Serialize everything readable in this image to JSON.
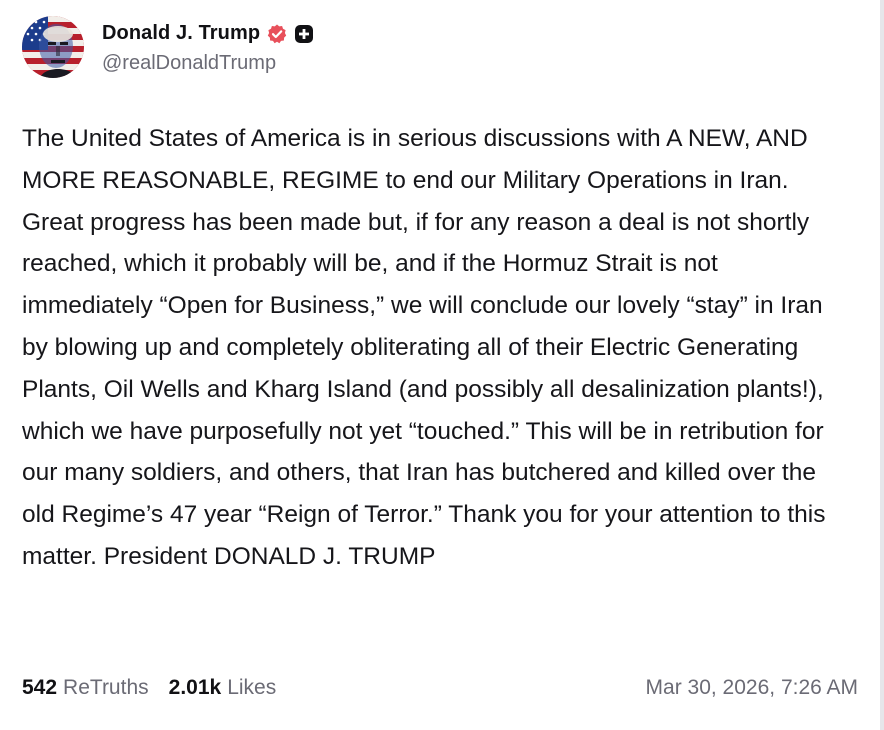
{
  "author": {
    "display_name": "Donald J. Trump",
    "handle": "@realDonaldTrump",
    "avatar": "avatar-flag-portrait",
    "badges": [
      "verified-icon",
      "plus-icon"
    ]
  },
  "post": {
    "body": "The United States of America is in serious discussions with A NEW, AND MORE REASONABLE, REGIME to end our Military Operations in Iran. Great progress has been made but, if for any reason a deal is not shortly reached, which it probably will be, and if the Hormuz Strait is not immediately “Open for Business,” we will conclude our lovely “stay” in Iran by blowing up and completely obliterating all of their Electric Generating Plants, Oil Wells and Kharg Island (and possibly all desalinization plants!), which we have purposefully not yet “touched.” This will be in retribution for our many soldiers, and others, that Iran has butchered and killed over the old Regime’s 47 year “Reign of Terror.” Thank you for your attention to this matter. President DONALD J. TRUMP"
  },
  "stats": {
    "retruths_count": "542",
    "retruths_label": "ReTruths",
    "likes_count": "2.01k",
    "likes_label": "Likes"
  },
  "timestamp": "Mar 30, 2026, 7:26 AM",
  "colors": {
    "verified_badge": "#e8505b",
    "plus_badge": "#111114",
    "muted_text": "#6b6b75"
  }
}
